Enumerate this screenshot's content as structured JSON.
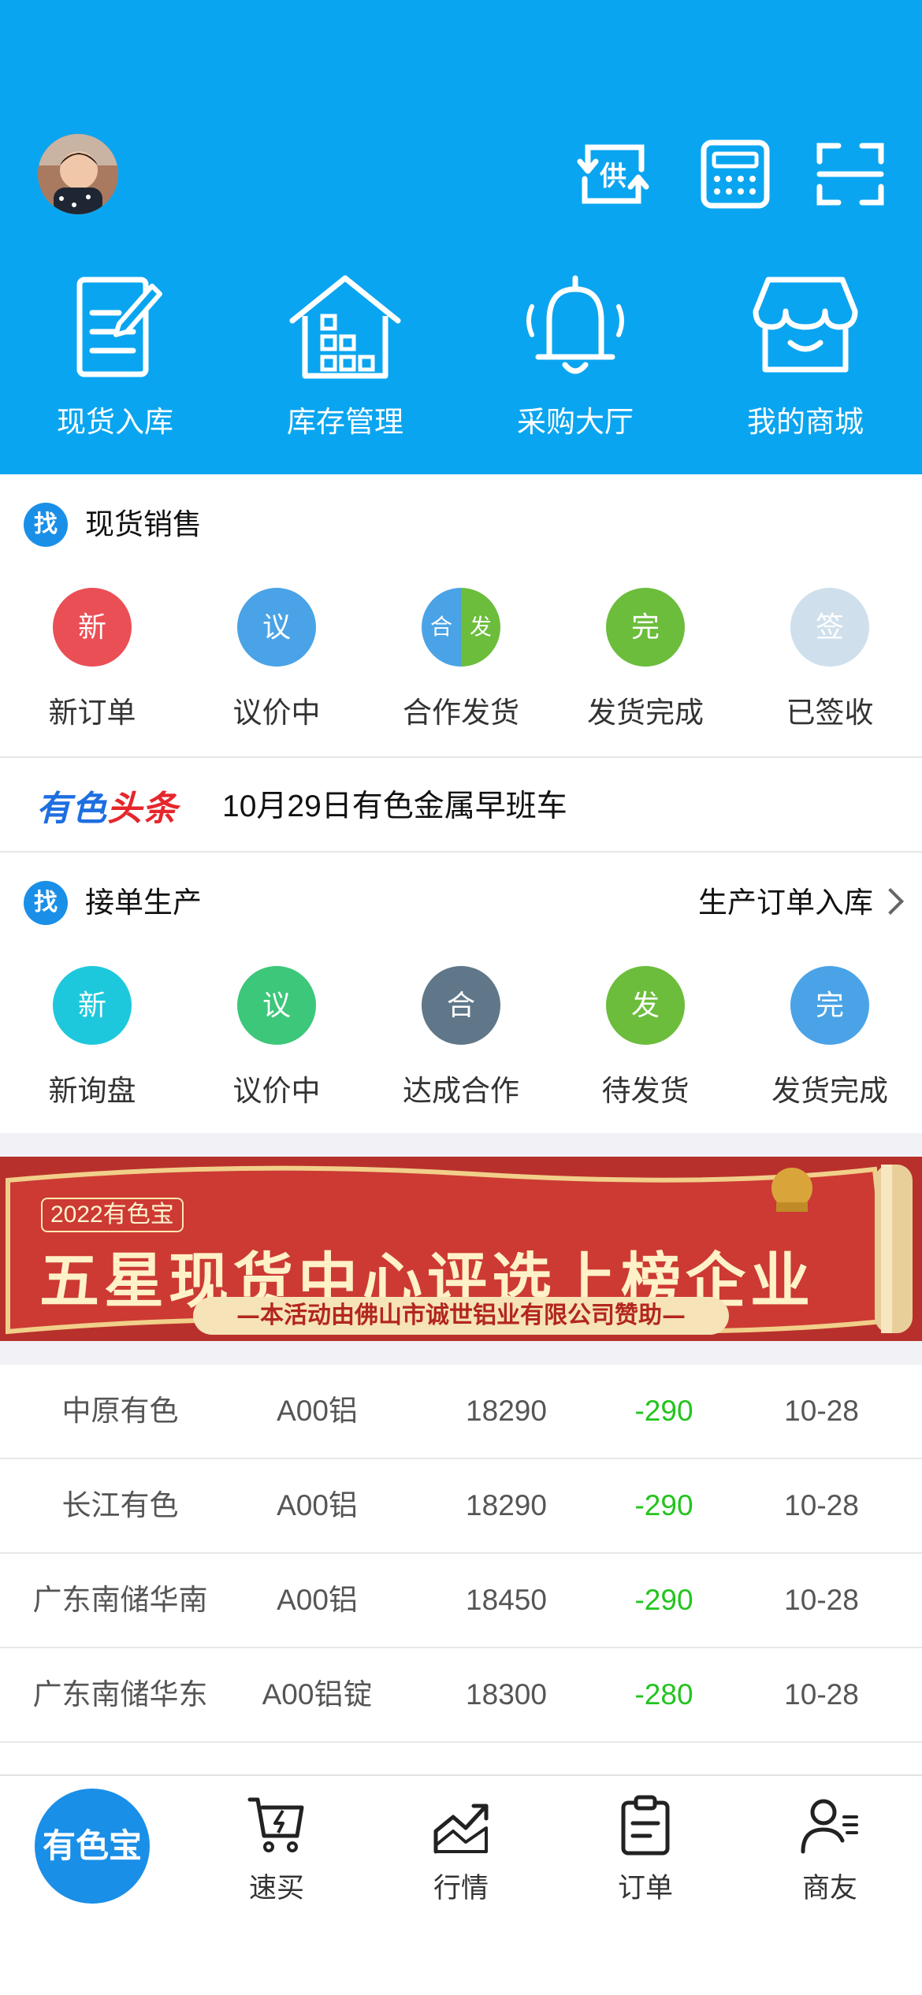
{
  "header": {
    "quick_actions": [
      {
        "label": "现货入库",
        "icon": "document-edit-icon"
      },
      {
        "label": "库存管理",
        "icon": "warehouse-icon"
      },
      {
        "label": "采购大厅",
        "icon": "bell-icon"
      },
      {
        "label": "我的商城",
        "icon": "shop-icon"
      }
    ],
    "supply_icon_text": "供",
    "top_icons": [
      "supply-swap-icon",
      "calculator-icon",
      "scan-icon"
    ]
  },
  "spot_sales": {
    "badge": "找",
    "title": "现货销售",
    "items": [
      {
        "short": "新",
        "label": "新订单",
        "color": "#ea4f55"
      },
      {
        "short": "议",
        "label": "议价中",
        "color": "#4aa3e6"
      },
      {
        "short_left": "合",
        "short_right": "发",
        "label": "合作发货"
      },
      {
        "short": "完",
        "label": "发货完成",
        "color": "#6cbd3c"
      },
      {
        "short": "签",
        "label": "已签收",
        "color": "#cfe0ec"
      }
    ]
  },
  "news": {
    "logo_a": "有色",
    "logo_b": "头条",
    "headline": "10月29日有色金属早班车"
  },
  "production": {
    "badge": "找",
    "title": "接单生产",
    "link": "生产订单入库",
    "items": [
      {
        "short": "新",
        "label": "新询盘",
        "color": "#1ec8dc"
      },
      {
        "short": "议",
        "label": "议价中",
        "color": "#3cc77a"
      },
      {
        "short": "合",
        "label": "达成合作",
        "color": "#5f7789"
      },
      {
        "short": "发",
        "label": "待发货",
        "color": "#6cbd3c"
      },
      {
        "short": "完",
        "label": "发货完成",
        "color": "#4aa3e6"
      }
    ]
  },
  "banner": {
    "tag": "2022有色宝",
    "title": "五星现货中心评选上榜企业",
    "subtitle": "—本活动由佛山市诚世铝业有限公司赞助—"
  },
  "prices": [
    {
      "market": "中原有色",
      "product": "A00铝",
      "price": "18290",
      "change": "-290",
      "date": "10-28"
    },
    {
      "market": "长江有色",
      "product": "A00铝",
      "price": "18290",
      "change": "-290",
      "date": "10-28"
    },
    {
      "market": "广东南储华南",
      "product": "A00铝",
      "price": "18450",
      "change": "-290",
      "date": "10-28"
    },
    {
      "market": "广东南储华东",
      "product": "A00铝锭",
      "price": "18300",
      "change": "-280",
      "date": "10-28"
    }
  ],
  "tabbar": {
    "home": "有色宝",
    "tabs": [
      {
        "label": "速买",
        "icon": "cart-icon"
      },
      {
        "label": "行情",
        "icon": "trend-chart-icon"
      },
      {
        "label": "订单",
        "icon": "clipboard-icon"
      },
      {
        "label": "商友",
        "icon": "contacts-icon"
      }
    ]
  },
  "colors": {
    "header_bg": "#0aa5f0",
    "accent": "#1a8fe8",
    "price_down": "#22c41d"
  }
}
